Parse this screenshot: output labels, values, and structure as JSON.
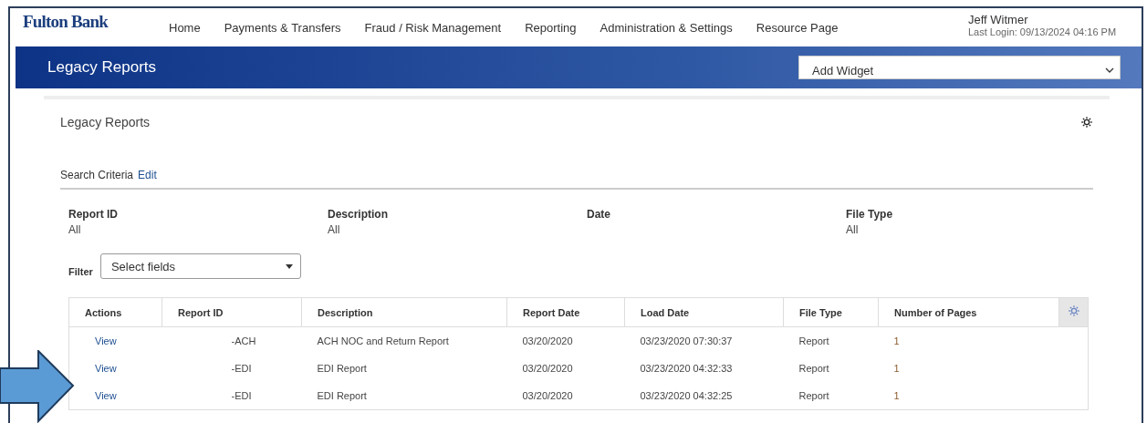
{
  "header": {
    "logo": "Fulton Bank",
    "nav": [
      "Home",
      "Payments & Transfers",
      "Fraud / Risk Management",
      "Reporting",
      "Administration & Settings",
      "Resource Page"
    ],
    "user": {
      "name": "Jeff Witmer",
      "last_login": "Last Login: 09/13/2024 04:16 PM"
    }
  },
  "banner": {
    "title": "Legacy Reports",
    "widget_select": {
      "value": "Add Widget"
    }
  },
  "card": {
    "title": "Legacy Reports",
    "search_criteria": {
      "label": "Search Criteria",
      "edit_link": "Edit"
    },
    "criteria": [
      {
        "label": "Report ID",
        "value": "All"
      },
      {
        "label": "Description",
        "value": "All"
      },
      {
        "label": "Date"
      },
      {
        "label": "File Type",
        "value": "All"
      }
    ],
    "filter": {
      "label": "Filter",
      "value": "Select fields"
    },
    "table": {
      "columns": [
        "Actions",
        "Report ID",
        "Description",
        "Report Date",
        "Load Date",
        "File Type",
        "Number of Pages"
      ],
      "rows": [
        {
          "action": "View",
          "report_id": "-ACH",
          "description": "ACH NOC and Return Report",
          "report_date": "03/20/2020",
          "load_date": "03/23/2020 07:30:37",
          "file_type": "Report",
          "pages": "1"
        },
        {
          "action": "View",
          "report_id": "-EDI",
          "description": "EDI Report",
          "report_date": "03/20/2020",
          "load_date": "03/23/2020 04:32:33",
          "file_type": "Report",
          "pages": "1"
        },
        {
          "action": "View",
          "report_id": "-EDI",
          "description": "EDI Report",
          "report_date": "03/20/2020",
          "load_date": "03/23/2020 04:32:25",
          "file_type": "Report",
          "pages": "1"
        }
      ]
    }
  }
}
